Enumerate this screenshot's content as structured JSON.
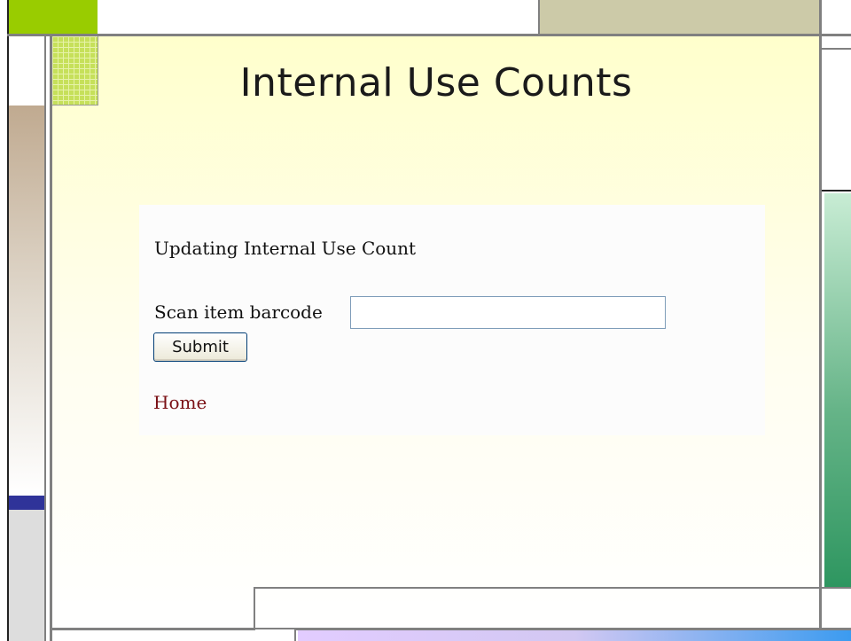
{
  "page": {
    "title": "Internal Use Counts"
  },
  "form": {
    "heading": "Updating Internal Use Count",
    "barcode_label": "Scan item barcode",
    "barcode_value": "",
    "submit_label": "Submit"
  },
  "nav": {
    "home_label": "Home"
  },
  "colors": {
    "accent_lime": "#99cc00",
    "link": "#7a0f14",
    "navy": "#2f3399",
    "green": "#2e9660"
  }
}
